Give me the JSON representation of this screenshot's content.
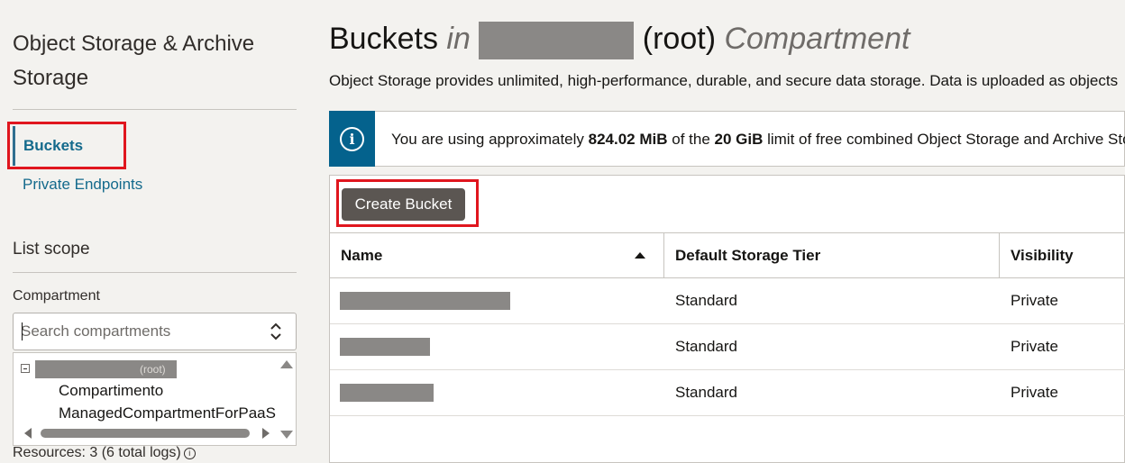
{
  "sidebar": {
    "title": "Object Storage & Archive Storage",
    "nav": [
      {
        "label": "Buckets",
        "active": true
      },
      {
        "label": "Private Endpoints",
        "active": false
      }
    ],
    "list_scope_heading": "List scope",
    "compartment_label": "Compartment",
    "search_placeholder": "Search compartments",
    "tree": {
      "root_suffix": "(root)",
      "items": [
        "Compartimento",
        "ManagedCompartmentForPaaS"
      ]
    },
    "resources_text": "Resources:  3 (6 total logs)"
  },
  "main": {
    "title_prefix": "Buckets",
    "title_in": "in",
    "title_root": "(root)",
    "title_suffix": "Compartment",
    "description": "Object Storage provides unlimited, high-performance, durable, and secure data storage. Data is uploaded as objects",
    "banner": {
      "text_1": "You are using approximately ",
      "usage": "824.02 MiB",
      "text_2": " of the ",
      "limit": "20 GiB",
      "text_3": " limit of free combined Object Storage and Archive Storage"
    },
    "create_button": "Create Bucket",
    "table": {
      "columns": [
        "Name",
        "Default Storage Tier",
        "Visibility"
      ],
      "rows": [
        {
          "tier": "Standard",
          "visibility": "Private"
        },
        {
          "tier": "Standard",
          "visibility": "Private"
        },
        {
          "tier": "Standard",
          "visibility": "Private"
        }
      ]
    }
  },
  "colors": {
    "link": "#146a8c",
    "highlight": "#e0161e",
    "info_strip": "#04628d",
    "button": "#5b5652"
  }
}
